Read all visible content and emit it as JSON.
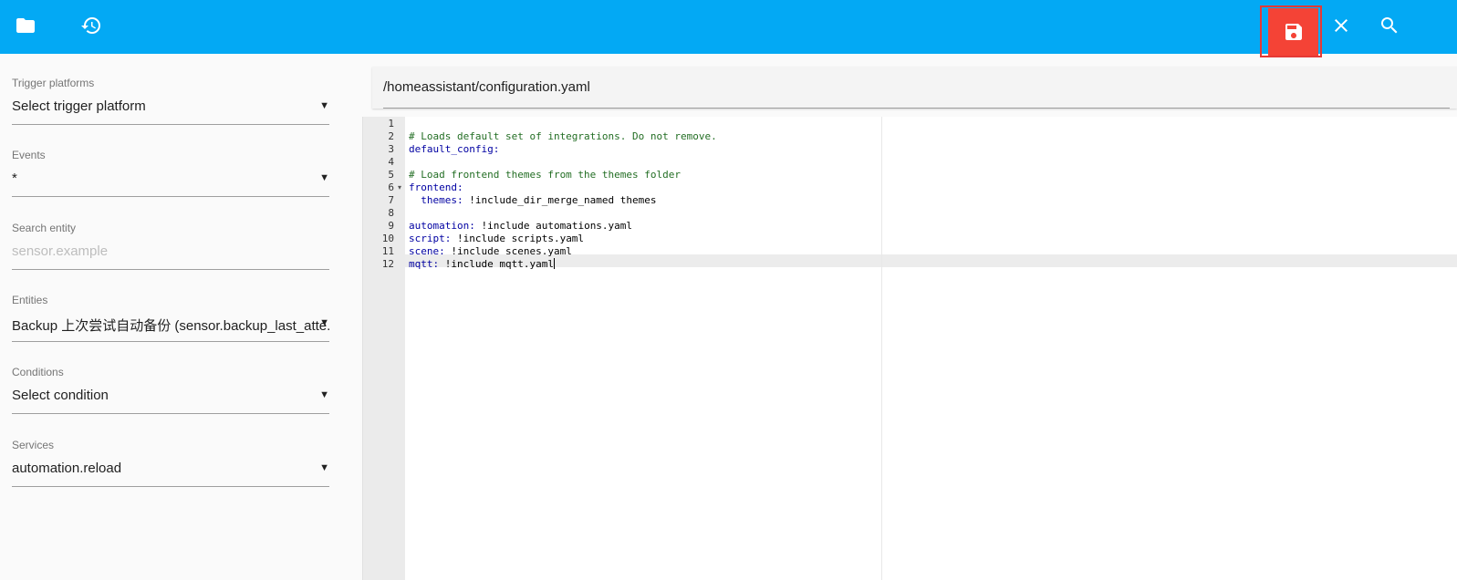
{
  "toolbar": {
    "icons": [
      "folder-icon",
      "history-icon",
      "save-icon",
      "close-icon",
      "search-icon"
    ],
    "colors": {
      "bar": "#03a9f4",
      "save": "#f44336"
    }
  },
  "sidebar": {
    "trigger": {
      "label": "Trigger platforms",
      "value": "Select trigger platform"
    },
    "events": {
      "label": "Events",
      "value": "*"
    },
    "search": {
      "label": "Search entity",
      "placeholder": "sensor.example"
    },
    "entities": {
      "label": "Entities",
      "value": "Backup 上次尝试自动备份 (sensor.backup_last_atte..."
    },
    "conditions": {
      "label": "Conditions",
      "value": "Select condition"
    },
    "services": {
      "label": "Services",
      "value": "automation.reload"
    },
    "dropdown_arrow": "▼"
  },
  "editor": {
    "path": "/homeassistant/configuration.yaml",
    "active_line": 12,
    "lines": [
      {
        "n": "1",
        "parts": []
      },
      {
        "n": "2",
        "parts": [
          {
            "t": "# Loads default set of integrations. Do not remove.",
            "c": "c-comment"
          }
        ]
      },
      {
        "n": "3",
        "parts": [
          {
            "t": "default_config:",
            "c": "c-key"
          }
        ]
      },
      {
        "n": "4",
        "parts": []
      },
      {
        "n": "5",
        "parts": [
          {
            "t": "# Load frontend themes from the themes folder",
            "c": "c-comment"
          }
        ]
      },
      {
        "n": "6",
        "fold": "▾",
        "parts": [
          {
            "t": "frontend:",
            "c": "c-key"
          }
        ]
      },
      {
        "n": "7",
        "parts": [
          {
            "t": "  ",
            "c": "c-val"
          },
          {
            "t": "themes:",
            "c": "c-key"
          },
          {
            "t": " !include_dir_merge_named themes",
            "c": "c-val"
          }
        ]
      },
      {
        "n": "8",
        "parts": []
      },
      {
        "n": "9",
        "parts": [
          {
            "t": "automation:",
            "c": "c-key"
          },
          {
            "t": " !include automations.yaml",
            "c": "c-val"
          }
        ]
      },
      {
        "n": "10",
        "parts": [
          {
            "t": "script:",
            "c": "c-key"
          },
          {
            "t": " !include scripts.yaml",
            "c": "c-val"
          }
        ]
      },
      {
        "n": "11",
        "parts": [
          {
            "t": "scene:",
            "c": "c-key"
          },
          {
            "t": " !include scenes.yaml",
            "c": "c-val"
          }
        ]
      },
      {
        "n": "12",
        "parts": [
          {
            "t": "mqtt:",
            "c": "c-key"
          },
          {
            "t": " !include mqtt.yaml",
            "c": "c-val"
          }
        ]
      }
    ]
  }
}
